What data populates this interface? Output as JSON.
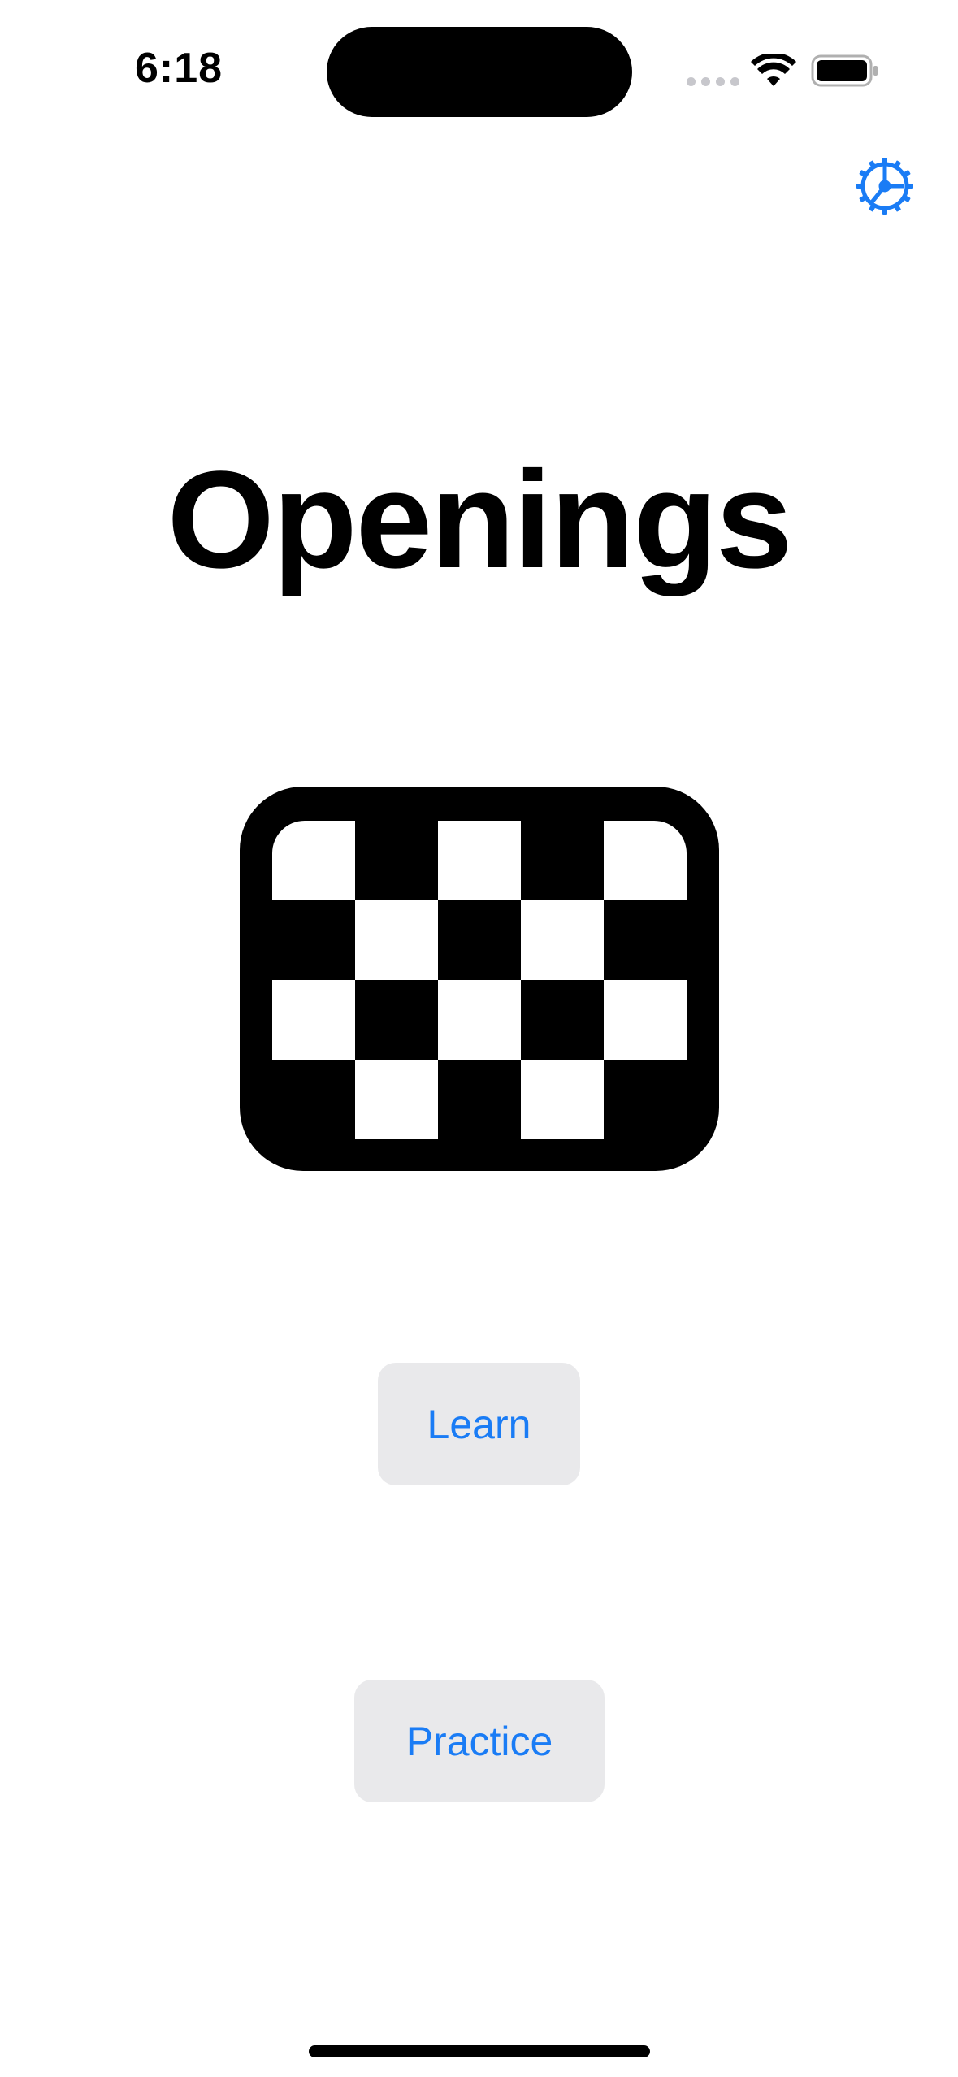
{
  "status_bar": {
    "time": "6:18",
    "icons": [
      "cellular-signal-icon",
      "wifi-icon",
      "battery-icon"
    ]
  },
  "header": {
    "settings_icon": "gear-icon"
  },
  "main": {
    "title": "Openings",
    "illustration_icon": "chessboard-icon",
    "learn_label": "Learn",
    "practice_label": "Practice"
  },
  "colors": {
    "accent": "#1a7cf5",
    "button_background": "#e9e9eb",
    "text": "#000000",
    "background": "#ffffff"
  }
}
